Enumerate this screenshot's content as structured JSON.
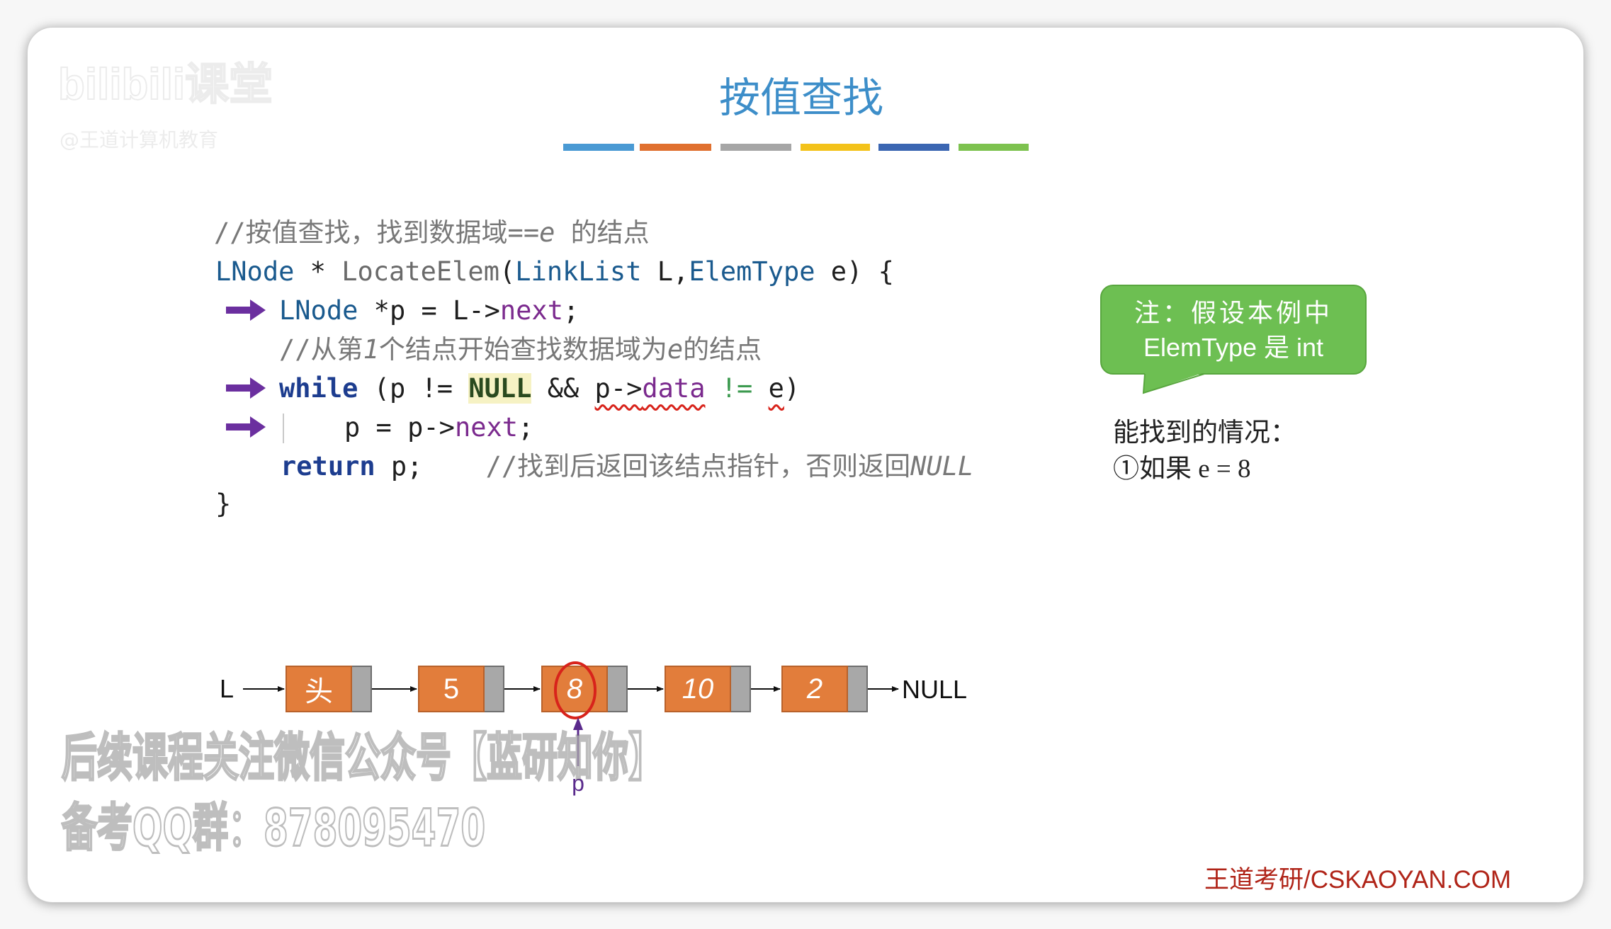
{
  "watermark": {
    "logo": "bilibili课堂",
    "account": "@王道计算机教育"
  },
  "title": "按值查找",
  "title_bar_colors": [
    "#4a9ad4",
    "#e0702f",
    "#a6a6a6",
    "#f3c21a",
    "#3b66b2",
    "#7dc24f"
  ],
  "colors": {
    "title": "#3d8ec9",
    "step_arrow": "#6b2f9f",
    "note_bubble": "#6dbf52",
    "node_fill": "#e27d3b",
    "node_pointer_field": "#a8a8a8",
    "match_circle": "#d8231b",
    "footer": "#b02418"
  },
  "icons": {
    "step_marker": "right-arrow-icon",
    "pointer": "up-arrow-icon"
  },
  "code": {
    "lines": [
      {
        "tokens": [
          {
            "text": "//按值查找，找到数据域==",
            "kind": "comment"
          },
          {
            "text": "e",
            "kind": "comment",
            "italic": true
          },
          {
            "text": " 的结点",
            "kind": "comment"
          }
        ]
      },
      {
        "tokens": [
          {
            "text": "LNode",
            "kind": "type"
          },
          {
            "text": " * ",
            "kind": "plain"
          },
          {
            "text": "LocateElem",
            "kind": "fn"
          },
          {
            "text": "(",
            "kind": "plain"
          },
          {
            "text": "LinkList",
            "kind": "type"
          },
          {
            "text": " L,",
            "kind": "plain"
          },
          {
            "text": "ElemType",
            "kind": "type"
          },
          {
            "text": " e) {",
            "kind": "plain"
          }
        ]
      },
      {
        "tokens": [
          {
            "text": "LNode",
            "kind": "type"
          },
          {
            "text": " *p = L->",
            "kind": "plain"
          },
          {
            "text": "next",
            "kind": "member"
          },
          {
            "text": ";",
            "kind": "plain"
          }
        ]
      },
      {
        "tokens": [
          {
            "text": "//从第",
            "kind": "comment"
          },
          {
            "text": "1",
            "kind": "comment",
            "italic": true
          },
          {
            "text": "个结点开始查找数据域为",
            "kind": "comment"
          },
          {
            "text": "e",
            "kind": "comment",
            "italic": true
          },
          {
            "text": "的结点",
            "kind": "comment"
          }
        ]
      },
      {
        "tokens": [
          {
            "text": "while",
            "kind": "keyword"
          },
          {
            "text": " (p != ",
            "kind": "plain"
          },
          {
            "text": "NULL",
            "kind": "null"
          },
          {
            "text": " && ",
            "kind": "plain"
          },
          {
            "text": "p->",
            "kind": "plain",
            "marked": true
          },
          {
            "text": "data",
            "kind": "member",
            "marked": true
          },
          {
            "text": " ",
            "kind": "plain"
          },
          {
            "text": "!=",
            "kind": "operator"
          },
          {
            "text": " ",
            "kind": "plain"
          },
          {
            "text": "e",
            "kind": "plain",
            "marked": true
          },
          {
            "text": ")",
            "kind": "plain"
          }
        ]
      },
      {
        "tokens": [
          {
            "text": "p = p->",
            "kind": "plain"
          },
          {
            "text": "next",
            "kind": "member"
          },
          {
            "text": ";",
            "kind": "plain"
          }
        ]
      },
      {
        "tokens": [
          {
            "text": "return",
            "kind": "keyword"
          },
          {
            "text": " p;    ",
            "kind": "plain"
          },
          {
            "text": "//找到后返回该结点指针，否则返回",
            "kind": "comment"
          },
          {
            "text": "NULL",
            "kind": "comment",
            "italic": true
          }
        ]
      },
      {
        "tokens": [
          {
            "text": "}",
            "kind": "plain"
          }
        ]
      }
    ]
  },
  "note": {
    "line1": "注：假设本例中",
    "line2": "ElemType 是 int"
  },
  "cases": {
    "heading": "能找到的情况：",
    "item": "①如果 e = 8"
  },
  "linked_list": {
    "head": "L",
    "nodes": [
      "头",
      "5",
      "8",
      "10",
      "2"
    ],
    "end": "NULL",
    "pointer": "p"
  },
  "overlay_watermark": {
    "line1": "后续课程关注微信公众号【蓝研知你】",
    "line2": "备考QQ群：878095470"
  },
  "footer": "王道考研/CSKAOYAN.COM"
}
